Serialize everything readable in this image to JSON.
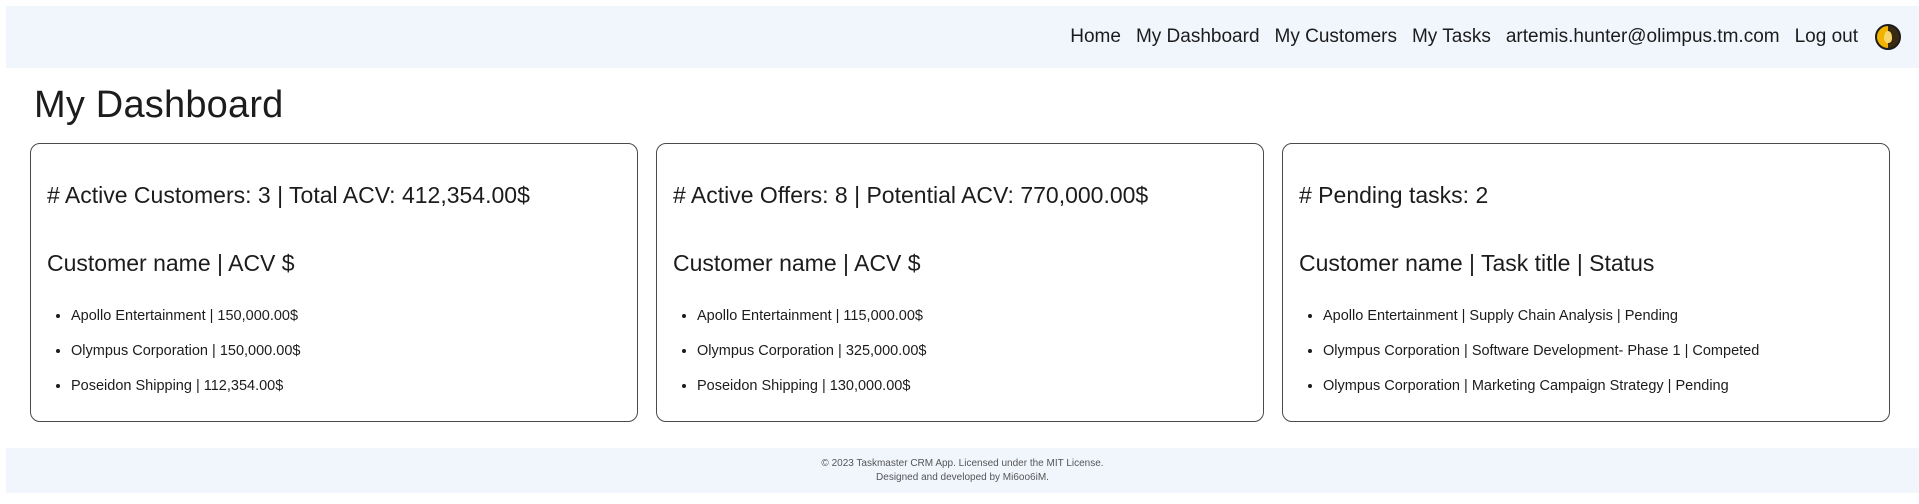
{
  "nav": {
    "items": [
      {
        "label": "Home"
      },
      {
        "label": "My Dashboard"
      },
      {
        "label": "My Customers"
      },
      {
        "label": "My Tasks"
      },
      {
        "label": "artemis.hunter@olimpus.tm.com"
      },
      {
        "label": "Log out"
      }
    ],
    "avatar_icon": "user-avatar-icon"
  },
  "page": {
    "title": "My Dashboard"
  },
  "cards": [
    {
      "summary": "# Active Customers: 3 | Total ACV: 412,354.00$",
      "header": "Customer name | ACV $",
      "items": [
        "Apollo Entertainment | 150,000.00$",
        "Olympus Corporation | 150,000.00$",
        "Poseidon Shipping | 112,354.00$"
      ]
    },
    {
      "summary": "# Active Offers: 8 | Potential ACV: 770,000.00$",
      "header": "Customer name | ACV $",
      "items": [
        "Apollo Entertainment | 115,000.00$",
        "Olympus Corporation | 325,000.00$",
        "Poseidon Shipping | 130,000.00$"
      ]
    },
    {
      "summary": "# Pending tasks: 2",
      "header": "Customer name | Task title | Status",
      "items": [
        "Apollo Entertainment | Supply Chain Analysis | Pending",
        "Olympus Corporation | Software Development- Phase 1 | Competed",
        "Olympus Corporation | Marketing Campaign Strategy | Pending"
      ]
    }
  ],
  "footer": {
    "line1": "© 2023 Taskmaster CRM App. Licensed under the MIT License.",
    "line2": "Designed and developed by Mi6oo6iM."
  },
  "colors": {
    "bar_background": "#f1f6fd",
    "card_border": "#4a4a4a",
    "text": "#1c1c1c"
  }
}
